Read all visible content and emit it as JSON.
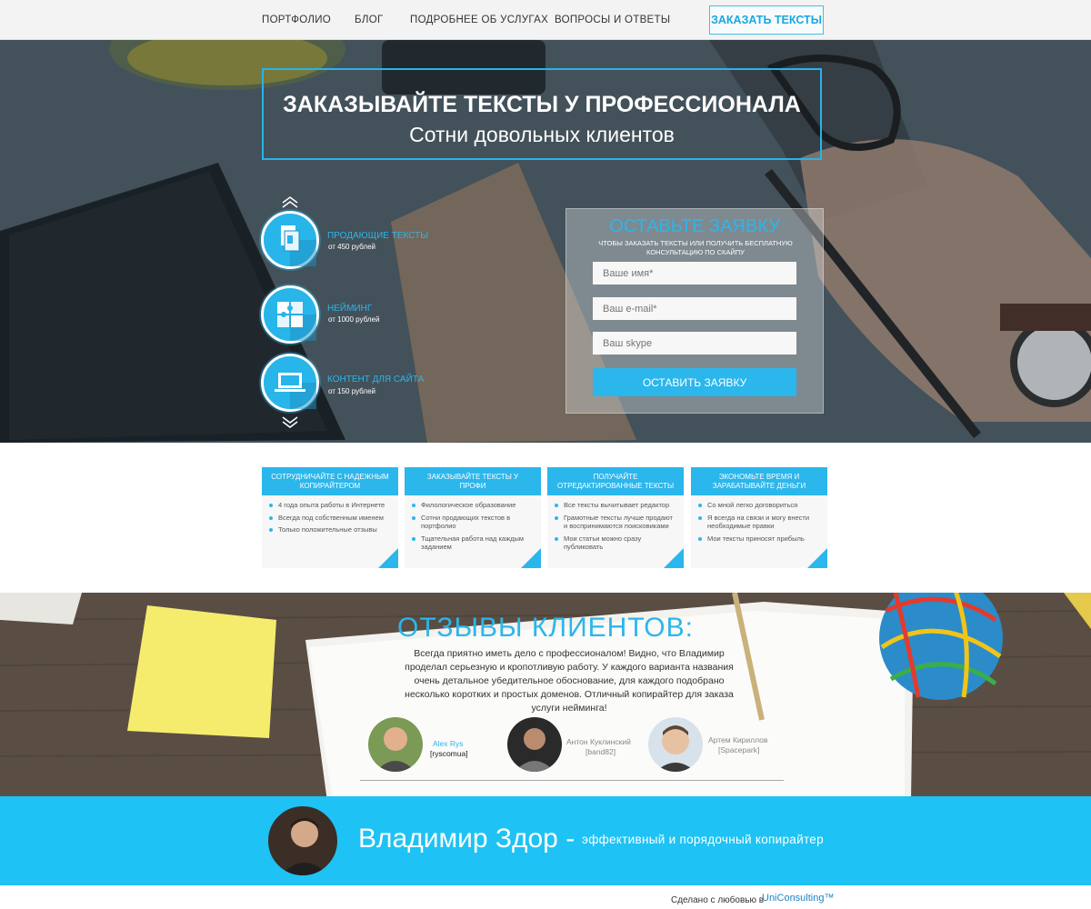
{
  "nav": {
    "items": [
      "ПОРТФОЛИО",
      "БЛОГ",
      "ПОДРОБНЕЕ ОБ УСЛУГАХ",
      "ВОПРОСЫ И ОТВЕТЫ"
    ],
    "cta": "ЗАКАЗАТЬ ТЕКСТЫ"
  },
  "hero": {
    "title": "ЗАКАЗЫВАЙТЕ ТЕКСТЫ У ПРОФЕССИОНАЛА",
    "subtitle": "Сотни довольных клиентов",
    "services": [
      {
        "title": "ПРОДАЮЩИЕ ТЕКСТЫ",
        "price": "от 450 рублей",
        "icon": "pages-icon"
      },
      {
        "title": "НЕЙМИНГ",
        "price": "от 1000 рублей",
        "icon": "puzzle-icon"
      },
      {
        "title": "КОНТЕНТ ДЛЯ САЙТА",
        "price": "от 150 рублей",
        "icon": "laptop-icon"
      }
    ]
  },
  "form": {
    "title": "ОСТАВЬТЕ ЗАЯВКУ",
    "subtitle": "ЧТОБЫ ЗАКАЗАТЬ ТЕКСТЫ ИЛИ ПОЛУЧИТЬ БЕСПЛАТНУЮ КОНСУЛЬТАЦИЮ ПО СКАЙПУ",
    "name_placeholder": "Ваше имя*",
    "email_placeholder": "Ваш e-mail*",
    "skype_placeholder": "Ваш skype",
    "submit": "ОСТАВИТЬ ЗАЯВКУ"
  },
  "cards": [
    {
      "title": "СОТРУДНИЧАЙТЕ С НАДЕЖНЫМ КОПИРАЙТЕРОМ",
      "items": [
        "4 года опыта работы в Интернете",
        "Всегда под собственным именем",
        "Только положительные отзывы"
      ]
    },
    {
      "title": "ЗАКАЗЫВАЙТЕ ТЕКСТЫ У ПРОФИ",
      "items": [
        "Филологическое образование",
        "Сотни продающих текстов в портфолио",
        "Тщательная работа над каждым заданием"
      ]
    },
    {
      "title": "ПОЛУЧАЙТЕ ОТРЕДАКТИРОВАННЫЕ ТЕКСТЫ",
      "items": [
        "Все тексты вычитывает редактор",
        "Грамотные тексты лучше продают и воспринимаются поисковиками",
        "Мои статьи можно сразу публиковать"
      ]
    },
    {
      "title": "ЭКОНОМЬТЕ ВРЕМЯ И ЗАРАБАТЫВАЙТЕ ДЕНЬГИ",
      "items": [
        "Со мной легко договориться",
        "Я всегда на связи и могу внести необходимые правки",
        "Мои тексты приносят прибыль"
      ]
    }
  ],
  "reviews": {
    "title": "ОТЗЫВЫ КЛИЕНТОВ:",
    "text": "Всегда приятно иметь дело с профессионалом! Видно, что Владимир проделал серьезную и кропотливую работу. У каждого варианта названия очень детальное убедительное обоснование, для каждого подобрано несколько коротких и простых доменов. Отличный копирайтер для заказа услуги нейминга!",
    "authors": [
      {
        "name": "Alex Rys",
        "handle": "[ryscomua]"
      },
      {
        "name": "Антон Куклинский",
        "handle": "[band82]"
      },
      {
        "name": "Артем Кириллов",
        "handle": "[Spacepark]"
      }
    ]
  },
  "footer": {
    "name": "Владимир Здор -",
    "tagline": "эффективный и порядочный копирайтер",
    "credit": "Сделано с любовью в",
    "credit_brand": "UniConsulting™"
  },
  "colors": {
    "accent": "#2bb6ec",
    "band": "#1ec2f4"
  }
}
